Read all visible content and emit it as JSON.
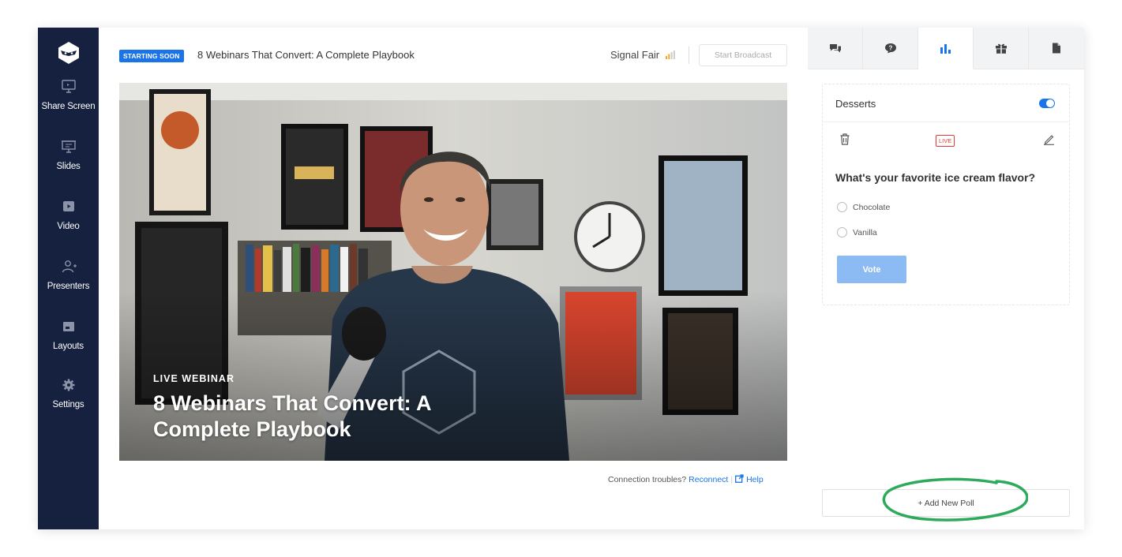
{
  "sidebar": {
    "items": [
      {
        "label": "Share Screen",
        "icon": "monitor-icon"
      },
      {
        "label": "Slides",
        "icon": "presentation-icon"
      },
      {
        "label": "Video",
        "icon": "play-icon"
      },
      {
        "label": "Presenters",
        "icon": "add-user-icon"
      },
      {
        "label": "Layouts",
        "icon": "layout-icon"
      },
      {
        "label": "Settings",
        "icon": "gear-icon"
      }
    ]
  },
  "header": {
    "badge": "STARTING SOON",
    "title": "8 Webinars That Convert: A Complete Playbook",
    "signal": "Signal Fair",
    "start_button": "Start Broadcast"
  },
  "video": {
    "kicker": "LIVE WEBINAR",
    "title": "8 Webinars That Convert: A Complete Playbook"
  },
  "connection": {
    "text": "Connection troubles?",
    "reconnect": "Reconnect",
    "help": "Help"
  },
  "panel": {
    "tabs": [
      {
        "icon": "chat-icon",
        "active": false
      },
      {
        "icon": "question-icon",
        "active": false
      },
      {
        "icon": "poll-chart-icon",
        "active": true
      },
      {
        "icon": "gift-icon",
        "active": false
      },
      {
        "icon": "document-icon",
        "active": false
      }
    ],
    "poll": {
      "name": "Desserts",
      "enabled": true,
      "status": "LIVE",
      "question": "What's your favorite ice cream flavor?",
      "options": [
        "Chocolate",
        "Vanilla"
      ],
      "vote_label": "Vote"
    },
    "add_poll_label": "+ Add New Poll"
  },
  "colors": {
    "sidebar": "#16213f",
    "accent": "#1a73e8",
    "live": "#e53935",
    "highlight": "#2eaa5c"
  }
}
